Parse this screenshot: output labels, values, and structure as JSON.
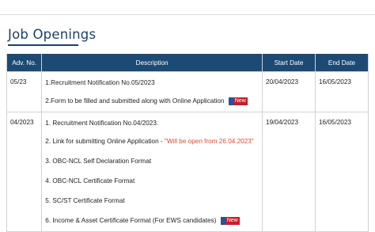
{
  "page": {
    "title": "Job Openings"
  },
  "table": {
    "headers": [
      "Adv. No.",
      "Description",
      "Start Date",
      "End Date"
    ],
    "rows": [
      {
        "adv_no": "05/23",
        "start": "20/04/2023",
        "end": "16/05/2023",
        "lines": [
          {
            "text": "1.Recruitment Notification No.05/2023",
            "highlight": "",
            "badge": ""
          },
          {
            "text": "2.Form to be filled and submitted along with Online Application ",
            "highlight": "",
            "badge": "New"
          }
        ]
      },
      {
        "adv_no": "04/2023",
        "start": "19/04/2023",
        "end": "16/05/2023",
        "lines": [
          {
            "text": "1. Recruitment Notification No.04/2023.",
            "highlight": "",
            "badge": ""
          },
          {
            "text": "2. Link for submitting Online Application - ",
            "highlight": "\"Will be open from 26.04.2023\"",
            "badge": ""
          },
          {
            "text": "3. OBC-NCL Self Declaration Format",
            "highlight": "",
            "badge": ""
          },
          {
            "text": "4. OBC-NCL Certificate Format",
            "highlight": "",
            "badge": ""
          },
          {
            "text": "5. SC/ST Certificate Format",
            "highlight": "",
            "badge": ""
          },
          {
            "text": "6. Income & Asset Certificate Format (For EWS candidates) ",
            "highlight": "",
            "badge": "New"
          }
        ]
      }
    ]
  }
}
